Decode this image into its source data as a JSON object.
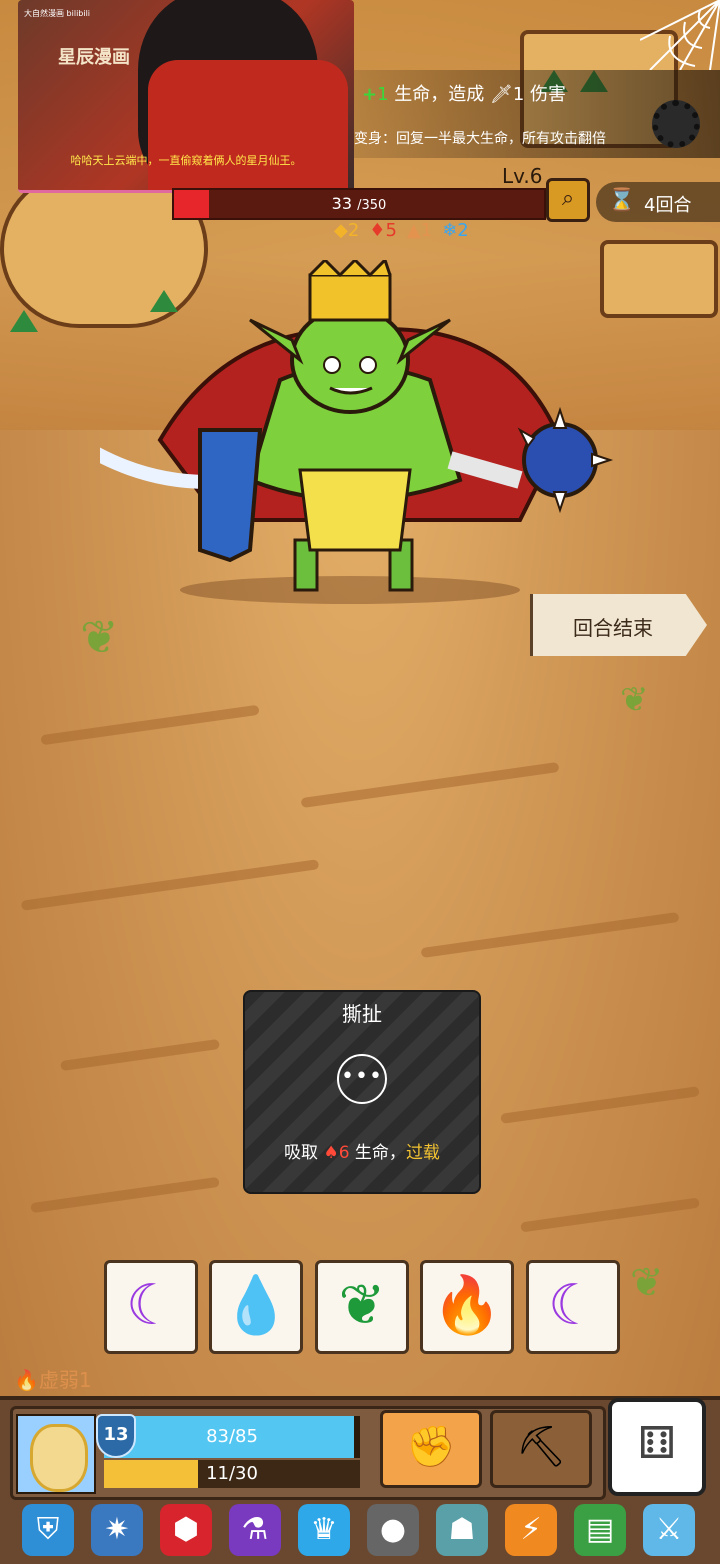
{
  "video_overlay": {
    "small_logo": "大自然漫画 bilibili",
    "title": "星辰漫画",
    "caption": "哈哈天上云端中，一直偷窥着俩人的星月仙王。"
  },
  "enemy": {
    "intent_line1_prefix": "+",
    "intent_line1_heal": "1",
    "intent_line1_mid": " 生命，造成 ",
    "intent_line1_damage": "1",
    "intent_line1_suffix": " 伤害",
    "intent_line2": "变身：回复一半最大生命，所有攻击翻倍",
    "level": "Lv.6",
    "hp_current": "33",
    "hp_max": "/350",
    "hp_fraction": 0.094,
    "turns": "4回合",
    "statuses": [
      {
        "icon": "◆",
        "value": "2",
        "color": "#f2b32a"
      },
      {
        "icon": "♦",
        "value": "5",
        "color": "#e63a2a"
      },
      {
        "icon": "▲",
        "value": "1",
        "color": "#e3934e"
      },
      {
        "icon": "❄",
        "value": "2",
        "color": "#3aa6f0"
      }
    ]
  },
  "end_turn_label": "回合结束",
  "tooltip": {
    "title": "撕扯",
    "icon": "•••",
    "desc_prefix": "吸取 ",
    "desc_value": "6",
    "desc_mid": " 生命，",
    "desc_keyword": "过载"
  },
  "dice_slots": [
    {
      "icon": "crescent-moon",
      "glyph": "☾",
      "color": "#9a3ae0"
    },
    {
      "icon": "water-drop",
      "glyph": "💧",
      "color": "#1e60c8"
    },
    {
      "icon": "leaf",
      "glyph": "❦",
      "color": "#1e9a3a"
    },
    {
      "icon": "fire",
      "glyph": "🔥",
      "color": "#e83a2a"
    },
    {
      "icon": "crescent-moon",
      "glyph": "☾",
      "color": "#9a3ae0"
    }
  ],
  "weak_status": "虚弱1",
  "player": {
    "shield": "13",
    "hp_text": "83/85",
    "hp_fraction": 0.976,
    "xp_text": "11/30",
    "xp_fraction": 0.367
  },
  "relics": [
    {
      "icon": "blue-shield-relic",
      "color": "#2e8fd6"
    },
    {
      "icon": "star-compass-relic",
      "color": "#3a78c0"
    },
    {
      "icon": "red-gem-relic",
      "color": "#d8242c"
    },
    {
      "icon": "purple-potion-relic",
      "color": "#7a3ac0"
    },
    {
      "icon": "ice-crown-relic",
      "color": "#2ea8e8"
    },
    {
      "icon": "rock-relic",
      "color": "#666666"
    },
    {
      "icon": "dragon-relic",
      "color": "#5aa0a8"
    },
    {
      "icon": "lightning-orb-relic",
      "color": "#f08a20"
    },
    {
      "icon": "green-book-relic",
      "color": "#3aa043"
    },
    {
      "icon": "ice-sword-relic",
      "color": "#5fb8e8"
    }
  ]
}
